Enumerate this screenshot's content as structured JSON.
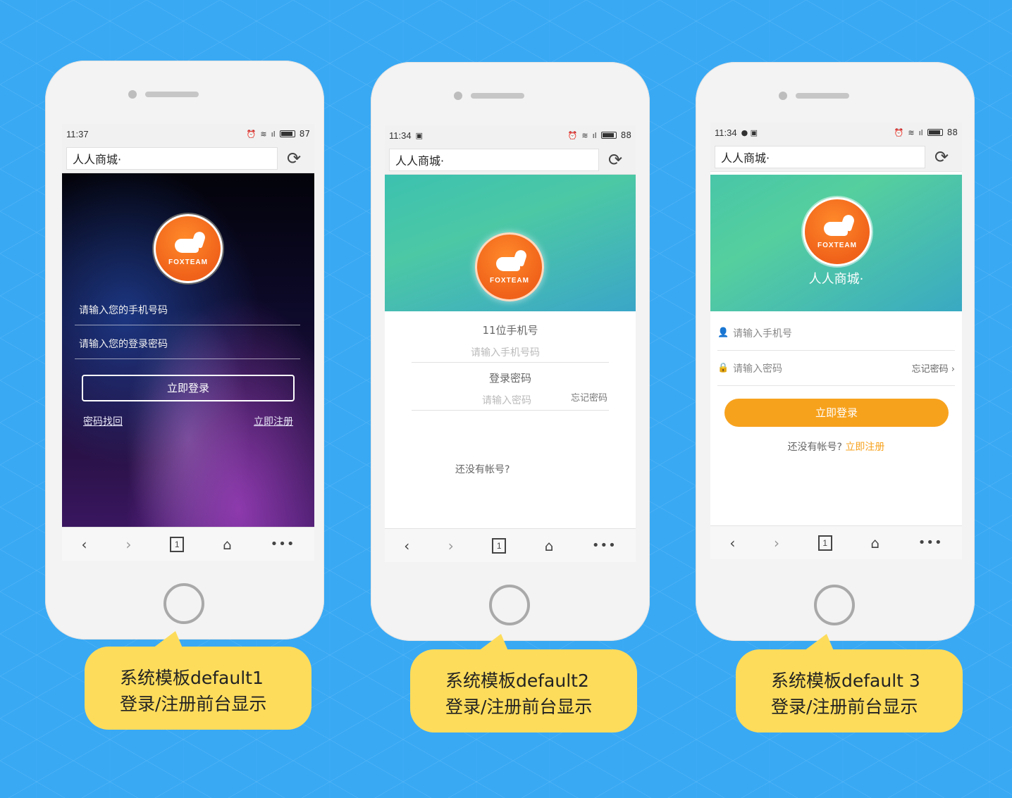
{
  "phones": [
    {
      "status": {
        "time": "11:37",
        "extra": "",
        "battery": "87"
      },
      "address": "人人商城·",
      "logo_text": "FOXTEAM",
      "fields": [
        "请输入您的手机号码",
        "请输入您的登录密码"
      ],
      "login_button": "立即登录",
      "forgot_link": "密码找回",
      "register_link": "立即注册",
      "caption_line1": "系统模板default1",
      "caption_line2": "登录/注册前台显示"
    },
    {
      "status": {
        "time": "11:34",
        "extra": "▣",
        "battery": "88"
      },
      "address": "人人商城·",
      "logo_text": "FOXTEAM",
      "phone_label": "11位手机号",
      "phone_placeholder": "请输入手机号码",
      "password_label": "登录密码",
      "password_placeholder": "请输入密码",
      "forgot": "忘记密码",
      "no_account": "还没有帐号?",
      "caption_line1": "系统模板default2",
      "caption_line2": "登录/注册前台显示"
    },
    {
      "status": {
        "time": "11:34",
        "extra": "● ▣",
        "battery": "88"
      },
      "address": "人人商城·",
      "logo_text": "FOXTEAM",
      "title": "人人商城·",
      "phone_placeholder": "请输入手机号",
      "password_placeholder": "请输入密码",
      "forgot": "忘记密码 ›",
      "login_button": "立即登录",
      "no_account": "还没有帐号?",
      "register_link": "立即注册",
      "caption_line1": "系统模板default 3",
      "caption_line2": "登录/注册前台显示"
    }
  ],
  "icons": {
    "alarm": "⏰",
    "wifi": "≋",
    "signal": "ıl",
    "refresh": "⟳",
    "back": "‹",
    "forward": "›",
    "tabs": "1",
    "home": "⌂",
    "more": "•••",
    "user": "👤",
    "lock": "🔒"
  },
  "colors": {
    "background": "#39a9f4",
    "callout": "#fddc5c",
    "accent_orange": "#f7a21d",
    "logo_orange": "#f0621a"
  }
}
